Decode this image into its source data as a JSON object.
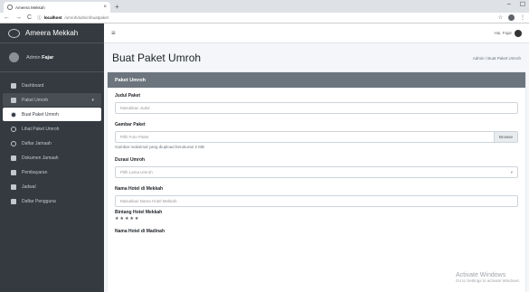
{
  "browser": {
    "tab_title": "Ameera Mekkah",
    "tab_close": "×",
    "new_tab": "+",
    "url_host": "localhost",
    "url_path": "/umroh/admin/buatpaket",
    "back": "←",
    "forward": "→",
    "reload": "C",
    "info": "ⓘ",
    "star": "☆",
    "win_min": "–",
    "win_max": "☐",
    "win_close": "⋮"
  },
  "sidebar": {
    "brand": "Ameera Mekkah",
    "user_prefix": "Admin ",
    "user_name": "Fajar",
    "items": [
      {
        "label": "Dashboard",
        "icon": "dashboard-icon"
      },
      {
        "label": "Paket Umroh",
        "icon": "book-icon"
      },
      {
        "label": "Buat Paket Umroh",
        "icon": "circle-icon"
      },
      {
        "label": "Lihat Paket Umroh",
        "icon": "circle-icon"
      },
      {
        "label": "Daftar Jamaah",
        "icon": "circle-icon"
      },
      {
        "label": "Dokumen Jamaah",
        "icon": "document-icon"
      },
      {
        "label": "Pembayaran",
        "icon": "tag-icon"
      },
      {
        "label": "Jadwal",
        "icon": "calendar-icon"
      },
      {
        "label": "Daftar Pengguna",
        "icon": "user-icon"
      }
    ],
    "caret": "▾"
  },
  "topnav": {
    "burger": "≡",
    "greeting": "Hai, Fajar"
  },
  "header": {
    "title": "Buat Paket Umroh",
    "breadcrumb": "Admin / Buat Paket Umroh"
  },
  "form": {
    "card_title": "Paket Umroh",
    "judul_label": "Judul Paket",
    "judul_placeholder": "Masukkan Judul",
    "gambar_label": "Gambar Paket",
    "gambar_placeholder": "Pilih Foto Paket",
    "browse": "Browse",
    "gambar_hint": "Gambar maksimal yang diupload berukuran 2 MB",
    "durasi_label": "Durasi Umroh",
    "durasi_selected": "Pilih Lama Umroh",
    "select_caret": "▾",
    "mekkah_label": "Nama Hotel di Mekkah",
    "mekkah_placeholder": "Masukkan Nama Hotel Mekkah",
    "bintang_label": "Bintang Hotel Mekkah",
    "stars": "★★★★★",
    "madinah_label": "Nama Hotel di Madinah"
  },
  "watermark": {
    "line1": "Activate Windows",
    "line2": "Go to Settings to activate Windows."
  }
}
